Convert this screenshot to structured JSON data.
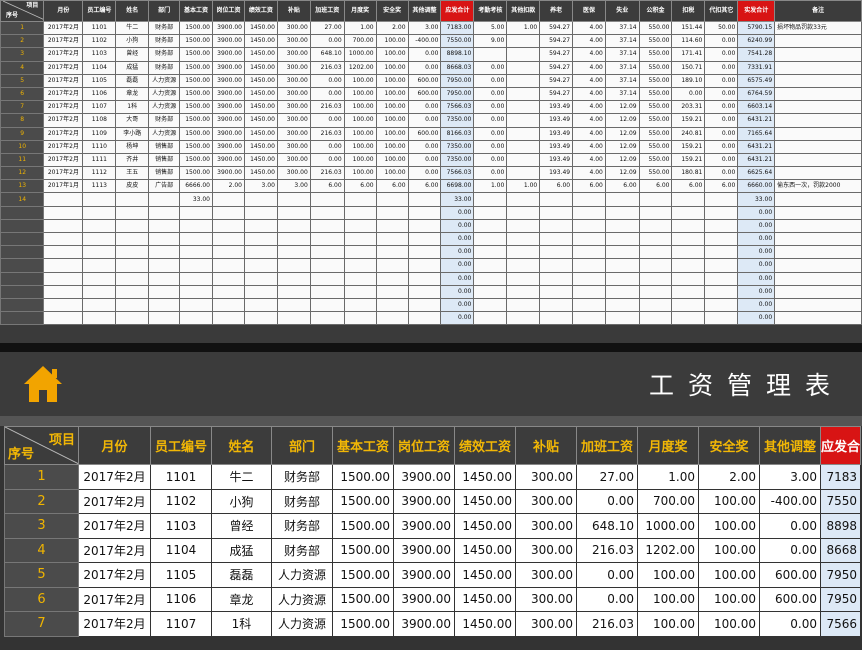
{
  "title": "工资管理表",
  "colors": {
    "accent_red": "#d81414",
    "seq_text": "#f0b400",
    "highlight_col": "#dde9f6",
    "home_icon": "#f2a400"
  },
  "home_icon": "home-icon",
  "header": {
    "corner_top": "项目",
    "corner_bottom": "序号",
    "columns": [
      "月份",
      "员工编号",
      "姓名",
      "部门",
      "基本工资",
      "岗位工资",
      "绩效工资",
      "补贴",
      "加班工资",
      "月度奖",
      "安全奖",
      "其他调整",
      "应发合计",
      "考勤考核",
      "其他扣款",
      "养老",
      "医保",
      "失业",
      "公积金",
      "扣税",
      "代扣其它",
      "实发合计",
      "备注"
    ],
    "big_header_last_cut": "应发合"
  },
  "rows": [
    [
      "1",
      "2017年2月",
      "1101",
      "牛二",
      "财务部",
      "1500.00",
      "3900.00",
      "1450.00",
      "300.00",
      "27.00",
      "1.00",
      "2.00",
      "3.00",
      "7183.00",
      "5.00",
      "1.00",
      "594.27",
      "4.00",
      "37.14",
      "550.00",
      "151.44",
      "50.00",
      "5790.15",
      "损坏物品罚款33元"
    ],
    [
      "2",
      "2017年2月",
      "1102",
      "小狗",
      "财务部",
      "1500.00",
      "3900.00",
      "1450.00",
      "300.00",
      "0.00",
      "700.00",
      "100.00",
      "-400.00",
      "7550.00",
      "9.00",
      "",
      "594.27",
      "4.00",
      "37.14",
      "550.00",
      "114.60",
      "0.00",
      "6240.99",
      ""
    ],
    [
      "3",
      "2017年2月",
      "1103",
      "曾经",
      "财务部",
      "1500.00",
      "3900.00",
      "1450.00",
      "300.00",
      "648.10",
      "1000.00",
      "100.00",
      "0.00",
      "8898.10",
      "",
      "",
      "594.27",
      "4.00",
      "37.14",
      "550.00",
      "171.41",
      "0.00",
      "7541.28",
      ""
    ],
    [
      "4",
      "2017年2月",
      "1104",
      "成猛",
      "财务部",
      "1500.00",
      "3900.00",
      "1450.00",
      "300.00",
      "216.03",
      "1202.00",
      "100.00",
      "0.00",
      "8668.03",
      "0.00",
      "",
      "594.27",
      "4.00",
      "37.14",
      "550.00",
      "150.71",
      "0.00",
      "7331.91",
      ""
    ],
    [
      "5",
      "2017年2月",
      "1105",
      "磊磊",
      "人力资源",
      "1500.00",
      "3900.00",
      "1450.00",
      "300.00",
      "0.00",
      "100.00",
      "100.00",
      "600.00",
      "7950.00",
      "0.00",
      "",
      "594.27",
      "4.00",
      "37.14",
      "550.00",
      "189.10",
      "0.00",
      "6575.49",
      ""
    ],
    [
      "6",
      "2017年2月",
      "1106",
      "章龙",
      "人力资源",
      "1500.00",
      "3900.00",
      "1450.00",
      "300.00",
      "0.00",
      "100.00",
      "100.00",
      "600.00",
      "7950.00",
      "0.00",
      "",
      "594.27",
      "4.00",
      "37.14",
      "550.00",
      "0.00",
      "0.00",
      "6764.59",
      ""
    ],
    [
      "7",
      "2017年2月",
      "1107",
      "1科",
      "人力资源",
      "1500.00",
      "3900.00",
      "1450.00",
      "300.00",
      "216.03",
      "100.00",
      "100.00",
      "0.00",
      "7566.03",
      "0.00",
      "",
      "193.49",
      "4.00",
      "12.09",
      "550.00",
      "203.31",
      "0.00",
      "6603.14",
      ""
    ],
    [
      "8",
      "2017年2月",
      "1108",
      "大哥",
      "财务部",
      "1500.00",
      "3900.00",
      "1450.00",
      "300.00",
      "0.00",
      "100.00",
      "100.00",
      "0.00",
      "7350.00",
      "0.00",
      "",
      "193.49",
      "4.00",
      "12.09",
      "550.00",
      "159.21",
      "0.00",
      "6431.21",
      ""
    ],
    [
      "9",
      "2017年2月",
      "1109",
      "李小路",
      "人力资源",
      "1500.00",
      "3900.00",
      "1450.00",
      "300.00",
      "216.03",
      "100.00",
      "100.00",
      "600.00",
      "8166.03",
      "0.00",
      "",
      "193.49",
      "4.00",
      "12.09",
      "550.00",
      "240.81",
      "0.00",
      "7165.64",
      ""
    ],
    [
      "10",
      "2017年2月",
      "1110",
      "杨坤",
      "销售部",
      "1500.00",
      "3900.00",
      "1450.00",
      "300.00",
      "0.00",
      "100.00",
      "100.00",
      "0.00",
      "7350.00",
      "0.00",
      "",
      "193.49",
      "4.00",
      "12.09",
      "550.00",
      "159.21",
      "0.00",
      "6431.21",
      ""
    ],
    [
      "11",
      "2017年2月",
      "1111",
      "齐井",
      "销售部",
      "1500.00",
      "3900.00",
      "1450.00",
      "300.00",
      "0.00",
      "100.00",
      "100.00",
      "0.00",
      "7350.00",
      "0.00",
      "",
      "193.49",
      "4.00",
      "12.09",
      "550.00",
      "159.21",
      "0.00",
      "6431.21",
      ""
    ],
    [
      "12",
      "2017年2月",
      "1112",
      "王五",
      "销售部",
      "1500.00",
      "3900.00",
      "1450.00",
      "300.00",
      "216.03",
      "100.00",
      "100.00",
      "0.00",
      "7566.03",
      "0.00",
      "",
      "193.49",
      "4.00",
      "12.09",
      "550.00",
      "180.81",
      "0.00",
      "6625.64",
      ""
    ],
    [
      "13",
      "2017年1月",
      "1113",
      "皮皮",
      "广告部",
      "6666.00",
      "2.00",
      "3.00",
      "3.00",
      "6.00",
      "6.00",
      "6.00",
      "6.00",
      "6698.00",
      "1.00",
      "1.00",
      "6.00",
      "6.00",
      "6.00",
      "6.00",
      "6.00",
      "6.00",
      "6660.00",
      "偷东西一次，罚款2000"
    ],
    [
      "14",
      "",
      "",
      "",
      "",
      "33.00",
      "",
      "",
      "",
      "",
      "",
      "",
      "",
      "33.00",
      "",
      "",
      "",
      "",
      "",
      "",
      "",
      "",
      "33.00",
      ""
    ]
  ],
  "empty_row_values": {
    "gross": "0.00",
    "net": "0.00"
  },
  "empty_row_count": 9,
  "big_rows": [
    [
      "1",
      "2017年2月",
      "1101",
      "牛二",
      "财务部",
      "1500.00",
      "3900.00",
      "1450.00",
      "300.00",
      "27.00",
      "1.00",
      "2.00",
      "3.00",
      "7183"
    ],
    [
      "2",
      "2017年2月",
      "1102",
      "小狗",
      "财务部",
      "1500.00",
      "3900.00",
      "1450.00",
      "300.00",
      "0.00",
      "700.00",
      "100.00",
      "-400.00",
      "7550"
    ],
    [
      "3",
      "2017年2月",
      "1103",
      "曾经",
      "财务部",
      "1500.00",
      "3900.00",
      "1450.00",
      "300.00",
      "648.10",
      "1000.00",
      "100.00",
      "0.00",
      "8898"
    ],
    [
      "4",
      "2017年2月",
      "1104",
      "成猛",
      "财务部",
      "1500.00",
      "3900.00",
      "1450.00",
      "300.00",
      "216.03",
      "1202.00",
      "100.00",
      "0.00",
      "8668"
    ],
    [
      "5",
      "2017年2月",
      "1105",
      "磊磊",
      "人力资源",
      "1500.00",
      "3900.00",
      "1450.00",
      "300.00",
      "0.00",
      "100.00",
      "100.00",
      "600.00",
      "7950"
    ],
    [
      "6",
      "2017年2月",
      "1106",
      "章龙",
      "人力资源",
      "1500.00",
      "3900.00",
      "1450.00",
      "300.00",
      "0.00",
      "100.00",
      "100.00",
      "600.00",
      "7950"
    ],
    [
      "7",
      "2017年2月",
      "1107",
      "1科",
      "人力资源",
      "1500.00",
      "3900.00",
      "1450.00",
      "300.00",
      "216.03",
      "100.00",
      "100.00",
      "0.00",
      "7566"
    ]
  ]
}
